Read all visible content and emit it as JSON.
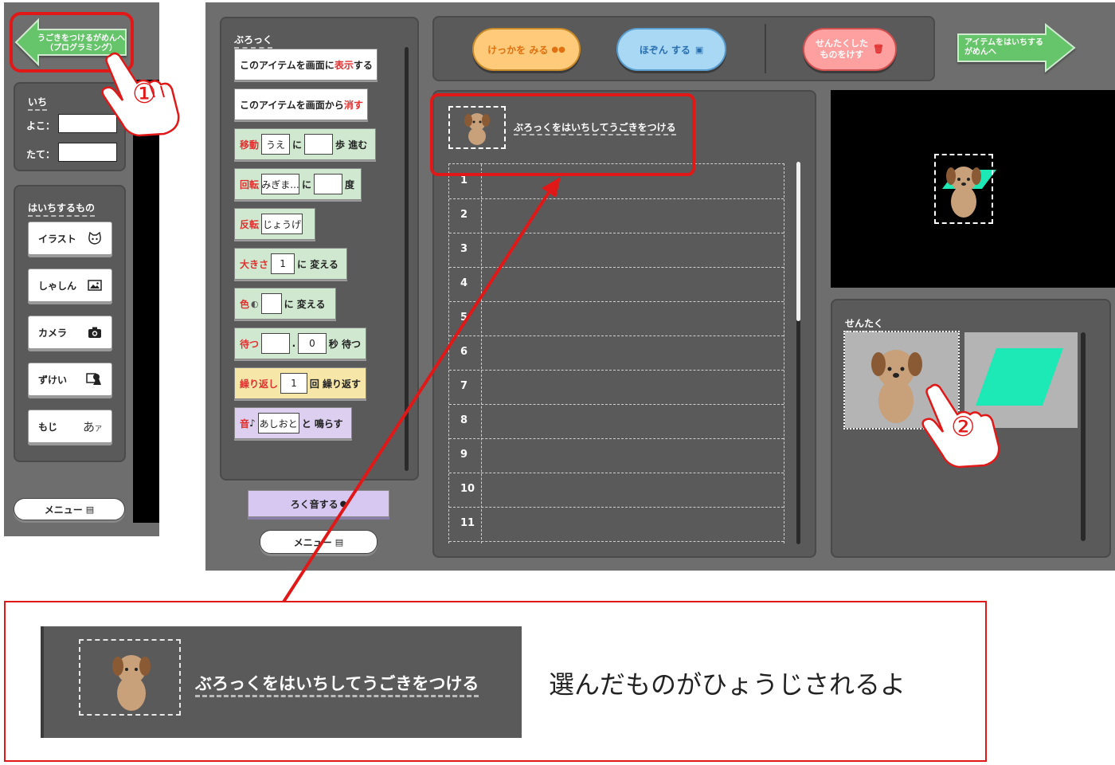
{
  "left": {
    "back_button": {
      "line1": "うごきをつけるがめんへ",
      "line2": "（プログラミング）"
    },
    "position": {
      "label": "いち",
      "x_label": "よこ：",
      "y_label": "たて："
    },
    "place": {
      "label": "はいちするもの",
      "items": [
        {
          "label": "イラスト",
          "icon": "cat-icon"
        },
        {
          "label": "しゃしん",
          "icon": "photo-icon"
        },
        {
          "label": "カメラ",
          "icon": "camera-icon"
        },
        {
          "label": "ずけい",
          "icon": "shapes-icon"
        },
        {
          "label": "もじ",
          "icon": "text-icon"
        }
      ]
    },
    "menu": "メニュー"
  },
  "header": {
    "result": "けっかを みる",
    "save": "ほぞん する",
    "delete_line1": "せんたくした",
    "delete_line2": "ものをけす",
    "next_line1": "アイテムをはいちする",
    "next_line2": "がめんへ"
  },
  "palette": {
    "label": "ぶろっく",
    "show": {
      "pre": "このアイテムを画面に",
      "red": "表示",
      "post": "する"
    },
    "hide": {
      "pre": "このアイテムを画面から",
      "red": "消す"
    },
    "move": {
      "red": "移動",
      "dir": "うえ",
      "ni": "に",
      "post": "歩 進む"
    },
    "rotate": {
      "red": "回転",
      "dir": "みぎま...",
      "ni": "に",
      "post": "度"
    },
    "flip": {
      "red": "反転",
      "dir": "じょうげ"
    },
    "size": {
      "red": "大きさ",
      "value": "1",
      "post": "に 変える"
    },
    "color": {
      "red": "色",
      "post": "に 変える"
    },
    "wait": {
      "red": "待つ",
      "dot": ".",
      "value": "0",
      "post": "秒 待つ"
    },
    "repeat": {
      "red": "繰り返し",
      "value": "1",
      "post": "回 繰り返す"
    },
    "sound": {
      "red": "音",
      "note": "♪",
      "value": "あしおと",
      "post": "と 鳴らす"
    },
    "record": "ろく音する",
    "menu": "メニュー"
  },
  "program": {
    "title": "ぶろっくをはいちしてうごきをつける",
    "rows": [
      "1",
      "2",
      "3",
      "4",
      "5",
      "6",
      "7",
      "8",
      "9",
      "10",
      "11"
    ]
  },
  "selection": {
    "label": "せんたく"
  },
  "annotations": {
    "step1": "①",
    "step2": "②",
    "zoom_title": "ぶろっくをはいちしてうごきをつける",
    "caption": "選んだものがひょうじされるよ"
  },
  "colors": {
    "annotation_red": "#e01818",
    "teal_shape": "#1de9b6",
    "panel_bg": "#6e6e6e"
  }
}
